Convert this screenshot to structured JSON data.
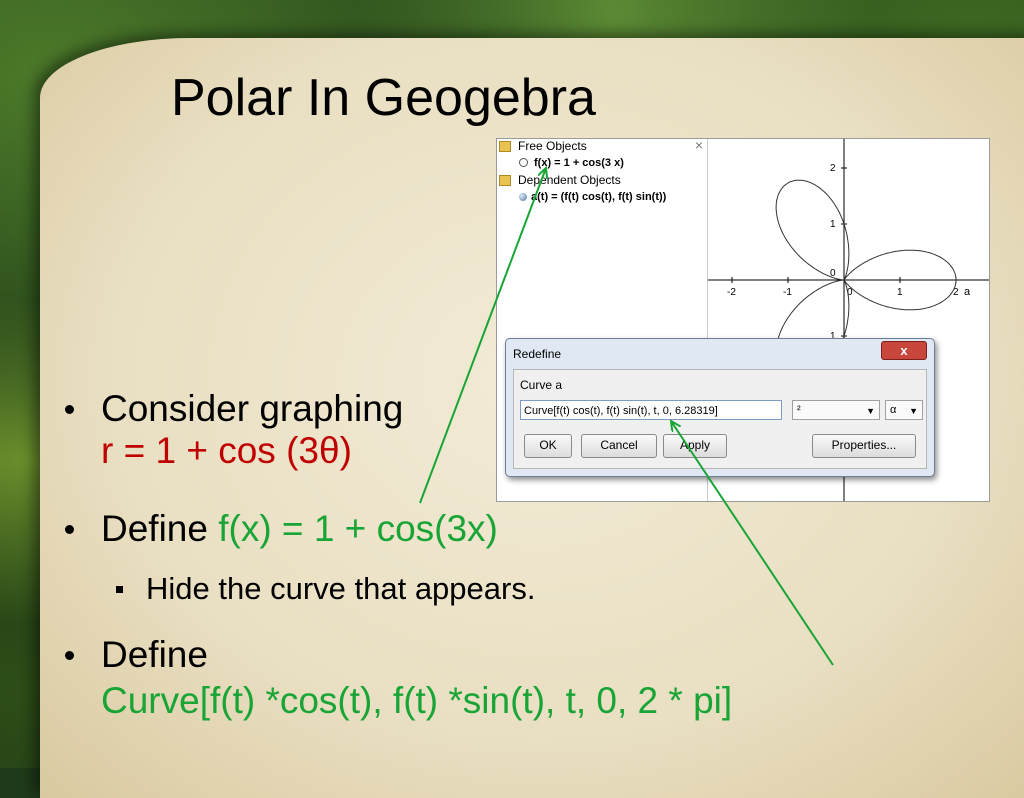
{
  "slide": {
    "title": "Polar In Geogebra"
  },
  "algebra_view": {
    "free_objects_label": "Free Objects",
    "free_item": "f(x) = 1 + cos(3 x)",
    "dependent_objects_label": "Dependent Objects",
    "dependent_item": "a(t) = (f(t) cos(t), f(t) sin(t))",
    "close_symbol": "×"
  },
  "graphics_view": {
    "x_ticks": [
      "-2",
      "-1",
      "0",
      "1",
      "2"
    ],
    "y_ticks": [
      "2",
      "1",
      "0",
      "1"
    ],
    "curve_label": "a"
  },
  "dialog": {
    "title": "Redefine",
    "close_symbol": "x",
    "label": "Curve a",
    "input_value": "Curve[f(t) cos(t), f(t) sin(t), t, 0, 6.28319]",
    "symbol_select": "²",
    "greek_select": "α",
    "ok_label": "OK",
    "cancel_label": "Cancel",
    "apply_label": "Apply",
    "properties_label": "Properties..."
  },
  "bullets": {
    "b1_text": "Consider graphing",
    "b1_eq": "r = 1 + cos (3θ)",
    "b2_text": "Define ",
    "b2_eq": "f(x) = 1 + cos(3x)",
    "sub_text": "Hide the curve that appears.",
    "b3_text": "Define",
    "b3_eq": "Curve[f(t) *cos(t), f(t) *sin(t), t, 0, 2 * pi]"
  },
  "colors": {
    "equation_red": "#c00000",
    "equation_green": "#18a536",
    "arrow_green": "#18a536"
  }
}
